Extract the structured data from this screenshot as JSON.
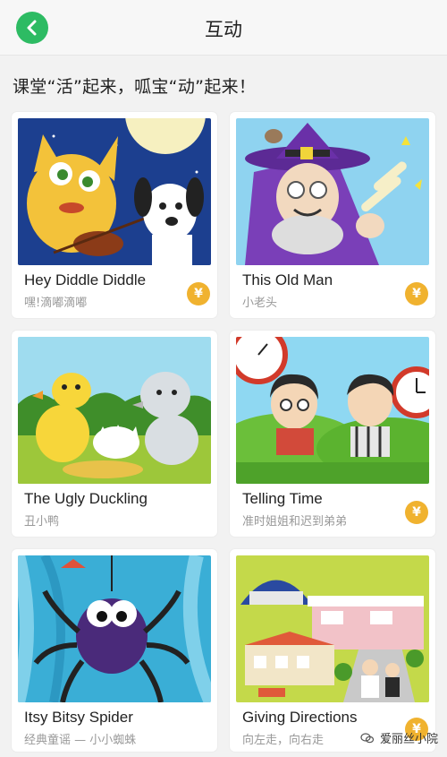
{
  "header": {
    "title": "互动",
    "back_icon": "chevron-left-icon",
    "accent": "#2dbb63"
  },
  "subtitle": "课堂“活”起来，呱宝“动”起来！",
  "coin_symbol": "¥",
  "cards": [
    {
      "title": "Hey Diddle Diddle",
      "subtitle": "嘿!滴嘟滴嘟",
      "paid": true
    },
    {
      "title": "This Old Man",
      "subtitle": "小老头",
      "paid": true
    },
    {
      "title": "The Ugly Duckling",
      "subtitle": "丑小鸭",
      "paid": false
    },
    {
      "title": "Telling Time",
      "subtitle": "准时姐姐和迟到弟弟",
      "paid": true
    },
    {
      "title": "Itsy Bitsy Spider",
      "subtitle": "经典童谣 — 小小蜘蛛",
      "paid": false
    },
    {
      "title": "Giving Directions",
      "subtitle": "向左走，向右走",
      "paid": true
    }
  ],
  "watermark": {
    "text": "爱丽丝小院"
  },
  "colors": {
    "coin": "#f0b22f",
    "background": "#f2f2f2"
  }
}
